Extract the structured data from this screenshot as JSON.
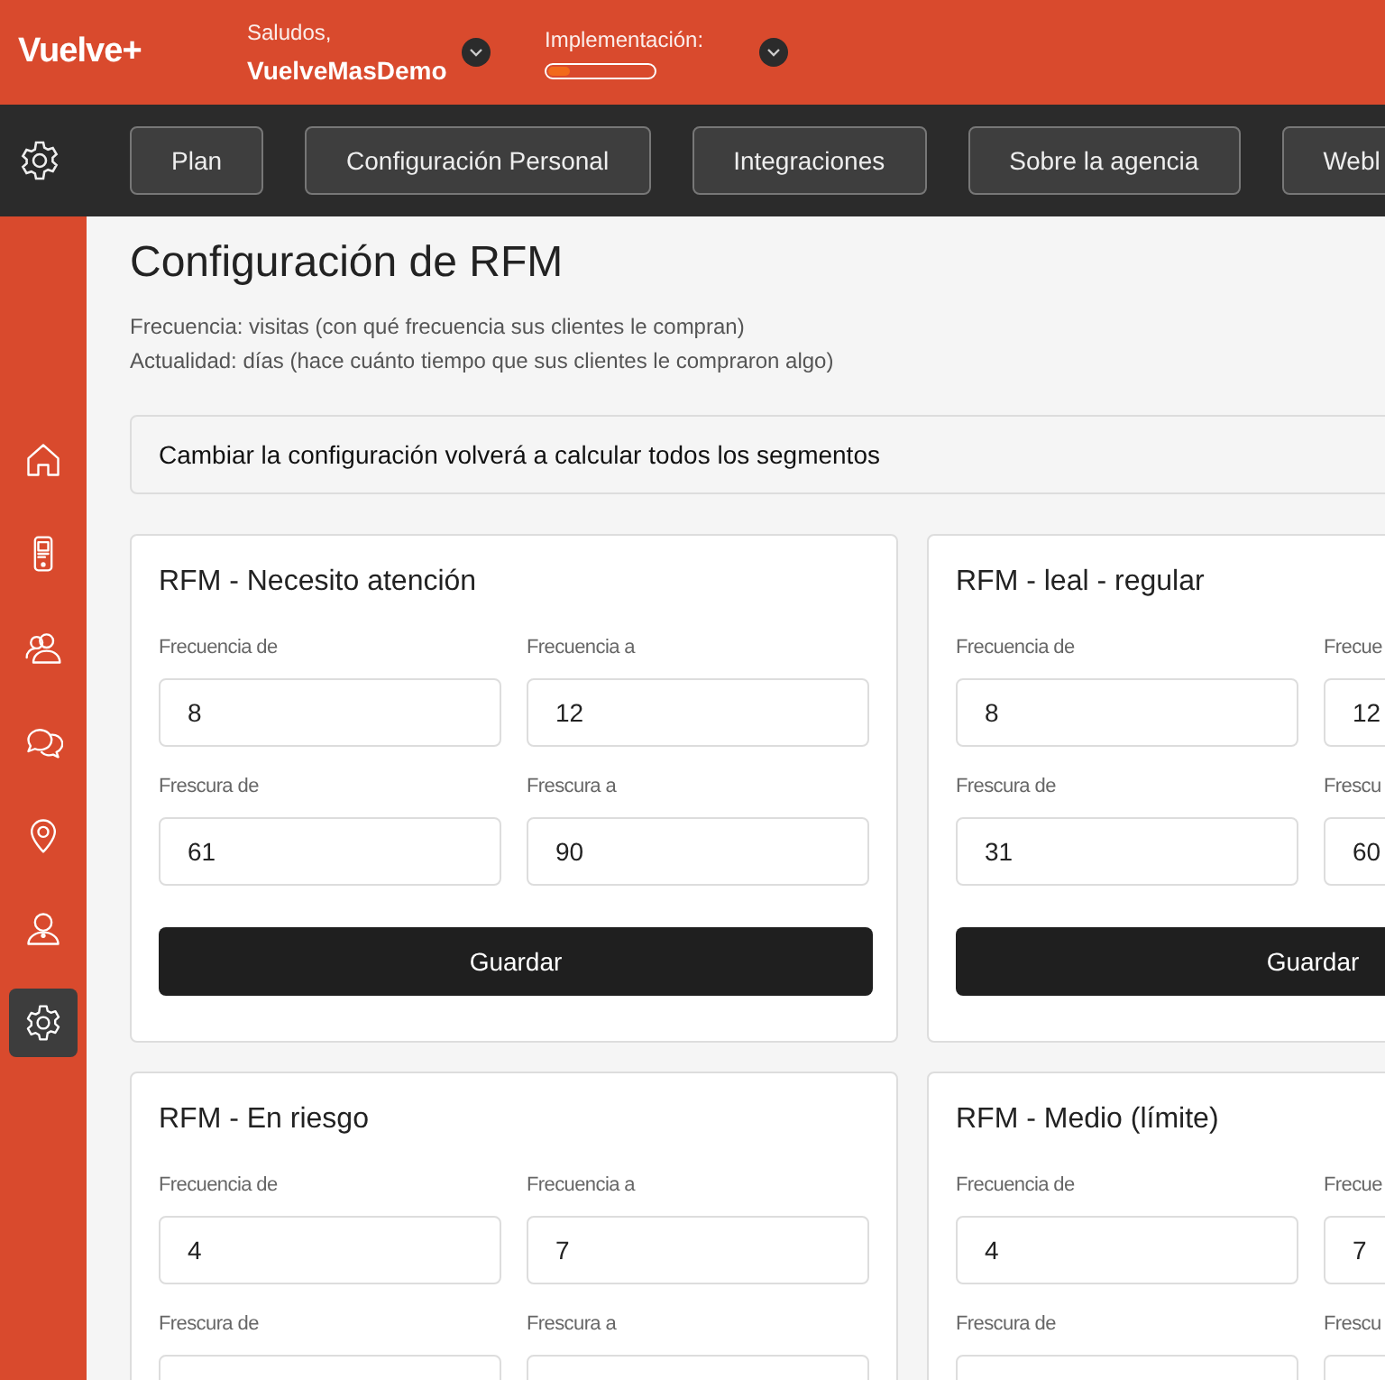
{
  "header": {
    "logo": "Vuelve+",
    "greeting": "Saludos,",
    "user": "VuelveMasDemo",
    "implementation": {
      "label": "Implementación:",
      "level": 0.2
    }
  },
  "settings_tabs": [
    {
      "label": "Plan"
    },
    {
      "label": "Configuración Personal"
    },
    {
      "label": "Integraciones"
    },
    {
      "label": "Sobre la agencia"
    },
    {
      "label": "Webl"
    }
  ],
  "sidebar": {
    "items": [
      {
        "kind": "home",
        "selected": false
      },
      {
        "kind": "phone",
        "selected": false
      },
      {
        "kind": "users",
        "selected": false
      },
      {
        "kind": "chat",
        "selected": false
      },
      {
        "kind": "pin",
        "selected": false
      },
      {
        "kind": "user",
        "selected": false
      },
      {
        "kind": "gear",
        "selected": true
      }
    ]
  },
  "page": {
    "title": "Configuración de RFM",
    "description": [
      "Frecuencia: visitas (con qué frecuencia sus clientes le compran)",
      "Actualidad: días (hace cuánto tiempo que sus clientes le compraron algo)"
    ],
    "notice": "Cambiar la configuración volverá a calcular todos los segmentos"
  },
  "cards": [
    {
      "title": "RFM - Necesito atención",
      "fields": [
        {
          "label": "Frecuencia de",
          "value": "8"
        },
        {
          "label": "Frecuencia a",
          "value": "12"
        },
        {
          "label": "Frescura de",
          "value": "61"
        },
        {
          "label": "Frescura a",
          "value": "90"
        }
      ],
      "button": "Guardar"
    },
    {
      "title": "RFM - leal - regular",
      "fields": [
        {
          "label": "Frecuencia de",
          "value": "8"
        },
        {
          "label": "Frecue",
          "value": "12"
        },
        {
          "label": "Frescura de",
          "value": "31"
        },
        {
          "label": "Frescu",
          "value": "60"
        }
      ],
      "button": "Guardar"
    },
    {
      "title": "RFM - En riesgo",
      "fields": [
        {
          "label": "Frecuencia de",
          "value": "4"
        },
        {
          "label": "Frecuencia a",
          "value": "7"
        },
        {
          "label": "Frescura de"
        },
        {
          "label": "Frescura a"
        }
      ]
    },
    {
      "title": "RFM - Medio (límite)",
      "fields": [
        {
          "label": "Frecuencia de",
          "value": "4"
        },
        {
          "label": "Frecue",
          "value": "7"
        },
        {
          "label": "Frescura de"
        },
        {
          "label": "Frescu"
        }
      ]
    }
  ]
}
